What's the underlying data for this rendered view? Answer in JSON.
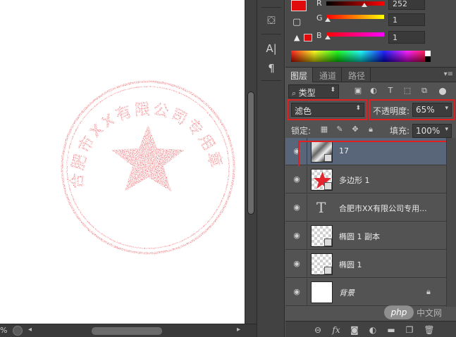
{
  "colors": {
    "stamp_red": "#e3262e",
    "selection_highlight": "#e02020",
    "selected_layer_bg": "#59667a",
    "panel_bg": "#535353"
  },
  "stamp": {
    "ring_text": "合肥市XX有限公司专用章"
  },
  "statusbar": {
    "zoom": "%"
  },
  "tools": {
    "icons": [
      "cube-icon",
      "text-vertical-icon",
      "paragraph-icon"
    ]
  },
  "color_panel": {
    "r_label": "R",
    "r_value": "252",
    "g_label": "G",
    "g_value": "1",
    "b_label": "B",
    "b_value": "1"
  },
  "layers_panel": {
    "tabs": [
      "图层",
      "通道",
      "路径"
    ],
    "filter_kind": "类型",
    "blend_mode": "滤色",
    "opacity_label": "不透明度:",
    "opacity_value": "65%",
    "lock_label": "锁定:",
    "fill_label": "填充:",
    "fill_value": "100%",
    "layers": [
      {
        "name": "17",
        "type": "smart-object",
        "selected": true
      },
      {
        "name": "多边形 1",
        "type": "shape"
      },
      {
        "name": "合肥市XX有限公司专用...",
        "type": "text"
      },
      {
        "name": "椭圆 1 副本",
        "type": "shape"
      },
      {
        "name": "椭圆 1",
        "type": "shape"
      },
      {
        "name": "背景",
        "type": "background",
        "locked": true
      }
    ]
  },
  "watermark": {
    "badge": "php",
    "site": "中文网"
  }
}
